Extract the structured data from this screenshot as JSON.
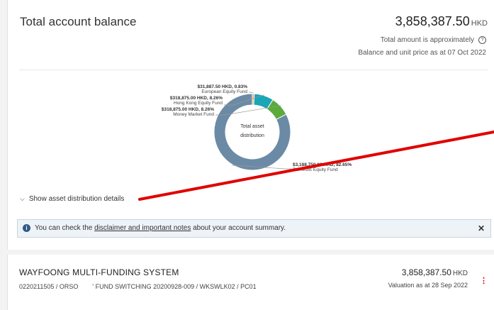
{
  "summary": {
    "title": "Total account balance",
    "balance": "3,858,387.50",
    "currency": "HKD",
    "approx_text": "Total amount is approximately",
    "as_at_text": "Balance and unit price as at 07 Oct 2022",
    "show_details": "Show asset distribution details",
    "notice_prefix": "You can check the",
    "notice_link": "disclaimer and important notes",
    "notice_suffix": "about your account summary."
  },
  "chart_data": {
    "type": "pie",
    "center_label_line1": "Total asset",
    "center_label_line2": "distribution",
    "slices": [
      {
        "name": "European Equity Fund",
        "amount": "$31,887.50 HKD",
        "percent_label": "0.83%",
        "value": 0.83,
        "color": "#e8a071"
      },
      {
        "name": "Hong Kong Equity Fund",
        "amount": "$318,875.00 HKD",
        "percent_label": "8.26%",
        "value": 8.26,
        "color": "#1aa6b7"
      },
      {
        "name": "Money Market Fund",
        "amount": "$318,875.00 HKD",
        "percent_label": "8.26%",
        "value": 8.26,
        "color": "#5aab3c"
      },
      {
        "name": "Domestic Equity Fund",
        "amount": "$3,188,750.00 HKD",
        "percent_label": "82.65%",
        "value": 82.65,
        "color": "#6b8aa5"
      }
    ]
  },
  "account": {
    "plan_name": "WAYFOONG MULTI-FUNDING SYSTEM",
    "account_line": "0220211505 / ORSO        ' FUND SWITCHING 20200928-009 / WKSWLK02 / PC01",
    "amount": "3,858,387.50",
    "currency": "HKD",
    "valuation": "Valuation as at 28 Sep 2022"
  },
  "annotation_color": "#e00000"
}
